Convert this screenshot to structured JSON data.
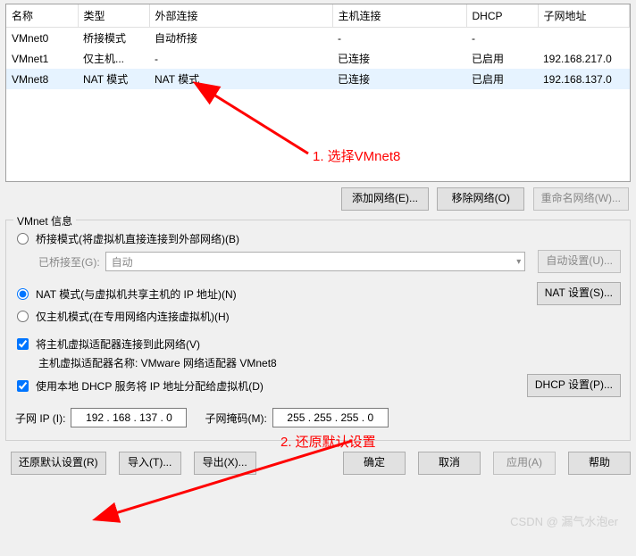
{
  "table": {
    "headers": [
      "名称",
      "类型",
      "外部连接",
      "主机连接",
      "DHCP",
      "子网地址"
    ],
    "rows": [
      {
        "name": "VMnet0",
        "type": "桥接模式",
        "ext": "自动桥接",
        "host": "-",
        "dhcp": "-",
        "subnet": ""
      },
      {
        "name": "VMnet1",
        "type": "仅主机...",
        "ext": "-",
        "host": "已连接",
        "dhcp": "已启用",
        "subnet": "192.168.217.0"
      },
      {
        "name": "VMnet8",
        "type": "NAT 模式",
        "ext": "NAT 模式",
        "host": "已连接",
        "dhcp": "已启用",
        "subnet": "192.168.137.0"
      }
    ]
  },
  "buttons_top": {
    "add": "添加网络(E)...",
    "remove": "移除网络(O)",
    "rename": "重命名网络(W)..."
  },
  "group": {
    "title": "VMnet 信息",
    "bridge": {
      "label": "桥接模式(将虚拟机直接连接到外部网络)(B)"
    },
    "bridge_to_label": "已桥接至(G):",
    "bridge_to_value": "自动",
    "auto_settings": "自动设置(U)...",
    "nat": {
      "label": "NAT 模式(与虚拟机共享主机的 IP 地址)(N)"
    },
    "nat_settings": "NAT 设置(S)...",
    "hostonly": {
      "label": "仅主机模式(在专用网络内连接虚拟机)(H)"
    },
    "connect_adapter": "将主机虚拟适配器连接到此网络(V)",
    "adapter_name_label": "主机虚拟适配器名称: VMware 网络适配器 VMnet8",
    "use_dhcp": "使用本地 DHCP 服务将 IP 地址分配给虚拟机(D)",
    "dhcp_settings": "DHCP 设置(P)...",
    "subnet_ip_label": "子网 IP (I):",
    "subnet_ip": "192 . 168 . 137 .  0",
    "subnet_mask_label": "子网掩码(M):",
    "subnet_mask": "255 . 255 . 255 .  0"
  },
  "bottom": {
    "restore": "还原默认设置(R)",
    "import": "导入(T)...",
    "export": "导出(X)...",
    "ok": "确定",
    "cancel": "取消",
    "apply": "应用(A)",
    "help": "帮助"
  },
  "annotations": {
    "a1": "1. 选择VMnet8",
    "a2": "2. 还原默认设置"
  },
  "watermark": "CSDN @ 漏气水泡er"
}
